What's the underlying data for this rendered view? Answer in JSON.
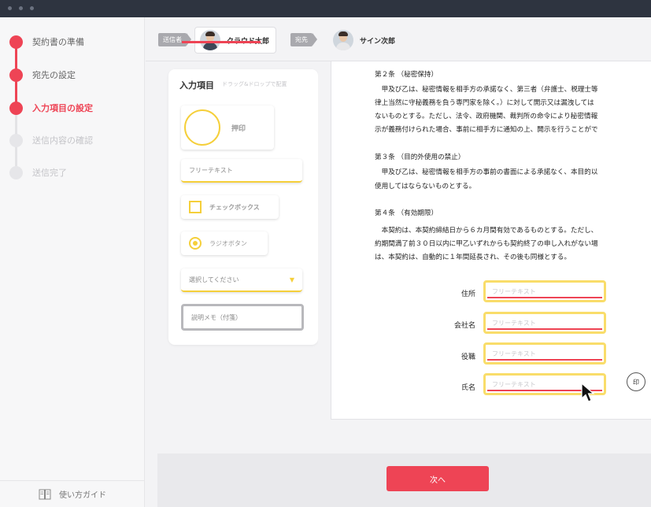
{
  "sidebar": {
    "steps": [
      {
        "label": "契約書の準備",
        "state": "done"
      },
      {
        "label": "宛先の設定",
        "state": "done"
      },
      {
        "label": "入力項目の設定",
        "state": "active"
      },
      {
        "label": "送信内容の確認",
        "state": "pending"
      },
      {
        "label": "送信完了",
        "state": "pending"
      }
    ],
    "guide_label": "使い方ガイド"
  },
  "topbar": {
    "sender_tag": "送信者",
    "sender_name": "クラウド太郎",
    "recipient_tag": "宛先",
    "recipient_name": "サイン次郎"
  },
  "panel": {
    "title": "入力項目",
    "hint": "ドラッグ&ドロップで配置",
    "tools": {
      "stamp": "押印",
      "free_text": "フリーテキスト",
      "checkbox": "チェックボックス",
      "radio": "ラジオボタン",
      "select": "選択してください",
      "memo": "説明メモ（付箋）"
    }
  },
  "document": {
    "lines": [
      "第２条 （秘密保持）",
      "　甲及び乙は、秘密情報を相手方の承諾なく、第三者（弁護士、税理士等",
      "律上当然に守秘義務を負う専門家を除く。）に対して開示又は漏洩しては",
      "ないものとする。ただし、法令、政府機関、裁判所の命令により秘密情報",
      "示が義務付けられた場合、事前に相手方に通知の上、開示を行うことがで",
      "第３条 （目的外使用の禁止）",
      "　甲及び乙は、秘密情報を相手方の事前の書面による承諾なく、本目的以",
      "使用してはならないものとする。",
      "第４条 （有効期限）",
      "　本契約は、本契約締結日から６カ月間有効であるものとする。ただし、",
      "約期間満了前３０日以内に甲乙いずれからも契約終了の申し入れがない場",
      "は、本契約は、自動的に１年間延長され、その後も同様とする。"
    ],
    "fields": [
      {
        "label": "住所",
        "placeholder": "フリーテキスト"
      },
      {
        "label": "会社名",
        "placeholder": "フリーテキスト"
      },
      {
        "label": "役職",
        "placeholder": "フリーテキスト"
      },
      {
        "label": "氏名",
        "placeholder": "フリーテキスト"
      }
    ],
    "seal_label": "印"
  },
  "footer": {
    "next_label": "次へ"
  },
  "colors": {
    "accent": "#ee4455",
    "field_highlight": "#f5cf3a",
    "titlebar": "#2e3440"
  }
}
